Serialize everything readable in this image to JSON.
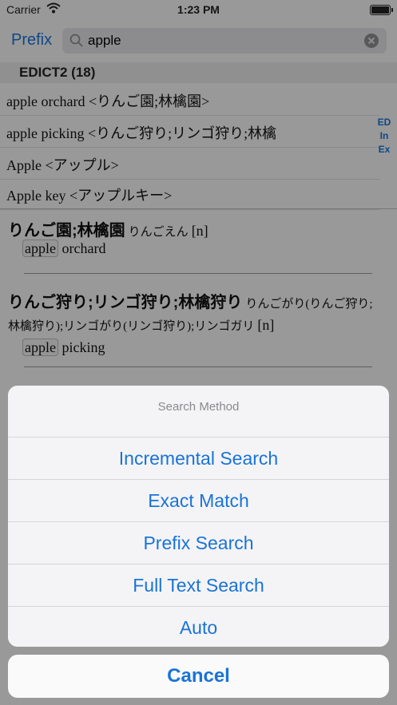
{
  "status_bar": {
    "carrier": "Carrier",
    "time": "1:23 PM",
    "battery_level": 1.0
  },
  "search": {
    "mode_button": "Prefix",
    "query": "apple"
  },
  "section": {
    "header": "EDICT2 (18)"
  },
  "results": [
    "apple orchard <りんご園;林檎園>",
    "apple picking <りんご狩り;リンゴ狩り;林檎",
    "Apple <アップル>",
    "Apple key <アップルキー>"
  ],
  "index_letters": [
    "ED",
    "In",
    "Ex"
  ],
  "entries": [
    {
      "headword": "りんご園;林檎園",
      "reading": "りんごえん",
      "pos": "[n]",
      "highlight": "apple",
      "gloss_rest": " orchard"
    },
    {
      "headword": "りんご狩り;リンゴ狩り;林檎狩り",
      "reading": "りんごがり(りんご狩り;林檎狩り);リンゴがり(リンゴ狩り);リンゴガリ",
      "pos": "[n]",
      "highlight": "apple",
      "gloss_rest": " picking"
    }
  ],
  "action_sheet": {
    "title": "Search Method",
    "options": [
      "Incremental Search",
      "Exact Match",
      "Prefix Search",
      "Full Text Search",
      "Auto"
    ],
    "cancel": "Cancel"
  },
  "colors": {
    "accent": "#1a73d8",
    "overlay": "rgba(0,0,0,0.38)"
  }
}
